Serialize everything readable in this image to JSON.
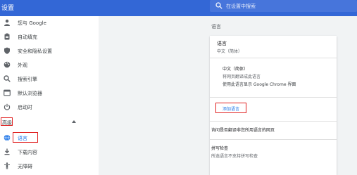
{
  "header": {
    "title": "设置",
    "search_placeholder": "在设置中搜索"
  },
  "sidebar": {
    "items": [
      {
        "label": "您与 Google",
        "icon": "person-icon"
      },
      {
        "label": "自动填充",
        "icon": "clipboard-icon"
      },
      {
        "label": "安全和隐私设置",
        "icon": "shield-icon"
      },
      {
        "label": "外观",
        "icon": "palette-icon"
      },
      {
        "label": "搜索引擎",
        "icon": "search-icon"
      },
      {
        "label": "默认浏览器",
        "icon": "browser-icon"
      },
      {
        "label": "启动时",
        "icon": "power-icon"
      }
    ],
    "advanced": {
      "label": "高级"
    },
    "advanced_items": [
      {
        "label": "语言",
        "icon": "globe-icon",
        "active": true
      },
      {
        "label": "下载内容",
        "icon": "download-icon"
      },
      {
        "label": "无障碍",
        "icon": "accessibility-icon"
      }
    ]
  },
  "main": {
    "section_title": "语言",
    "language": {
      "heading": "语言",
      "current": "中文（简体）",
      "entry_name": "中文（简体）",
      "entry_desc1": "将网页翻译成此语言",
      "entry_desc2": "使用此语言显示 Google Chrome 界面",
      "add_language": "添加语言",
      "translate_prompt": "询问是否翻译非您所用语言的网页"
    },
    "spellcheck": {
      "heading": "拼写检查",
      "desc": "所选语言不支持拼写检查"
    }
  },
  "colors": {
    "header": "#3367d6",
    "accent": "#1a73e8",
    "highlight": "#e02020"
  }
}
